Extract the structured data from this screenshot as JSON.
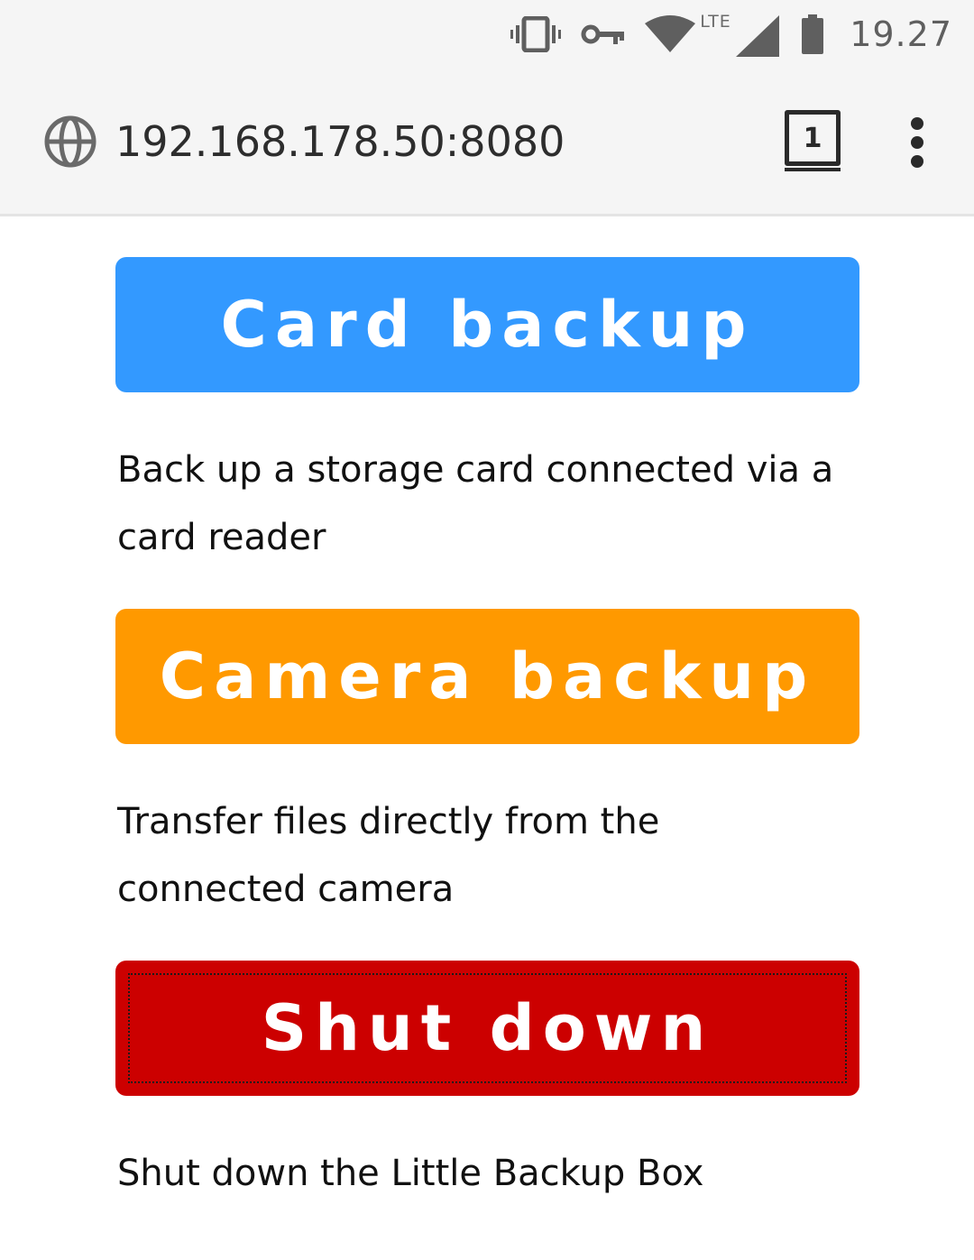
{
  "status_bar": {
    "network_label": "LTE",
    "time": "19.27",
    "icons": [
      "vibrate-icon",
      "vpn-key-icon",
      "wifi-icon",
      "lte-signal-icon",
      "battery-icon"
    ]
  },
  "browser": {
    "url": "192.168.178.50:8080",
    "tab_count": "1",
    "icons": [
      "globe-icon",
      "tab-switcher-icon",
      "more-menu-icon"
    ]
  },
  "content": {
    "card_backup": {
      "button_label": "Card backup",
      "description": "Back up a storage card connected via a card reader",
      "color": "#3399ff"
    },
    "camera_backup": {
      "button_label": "Camera backup",
      "description": "Transfer files directly from the connected camera",
      "color": "#ff9900"
    },
    "shutdown": {
      "button_label": "Shut down",
      "description": "Shut down the Little Backup Box",
      "color": "#cc0000"
    }
  }
}
